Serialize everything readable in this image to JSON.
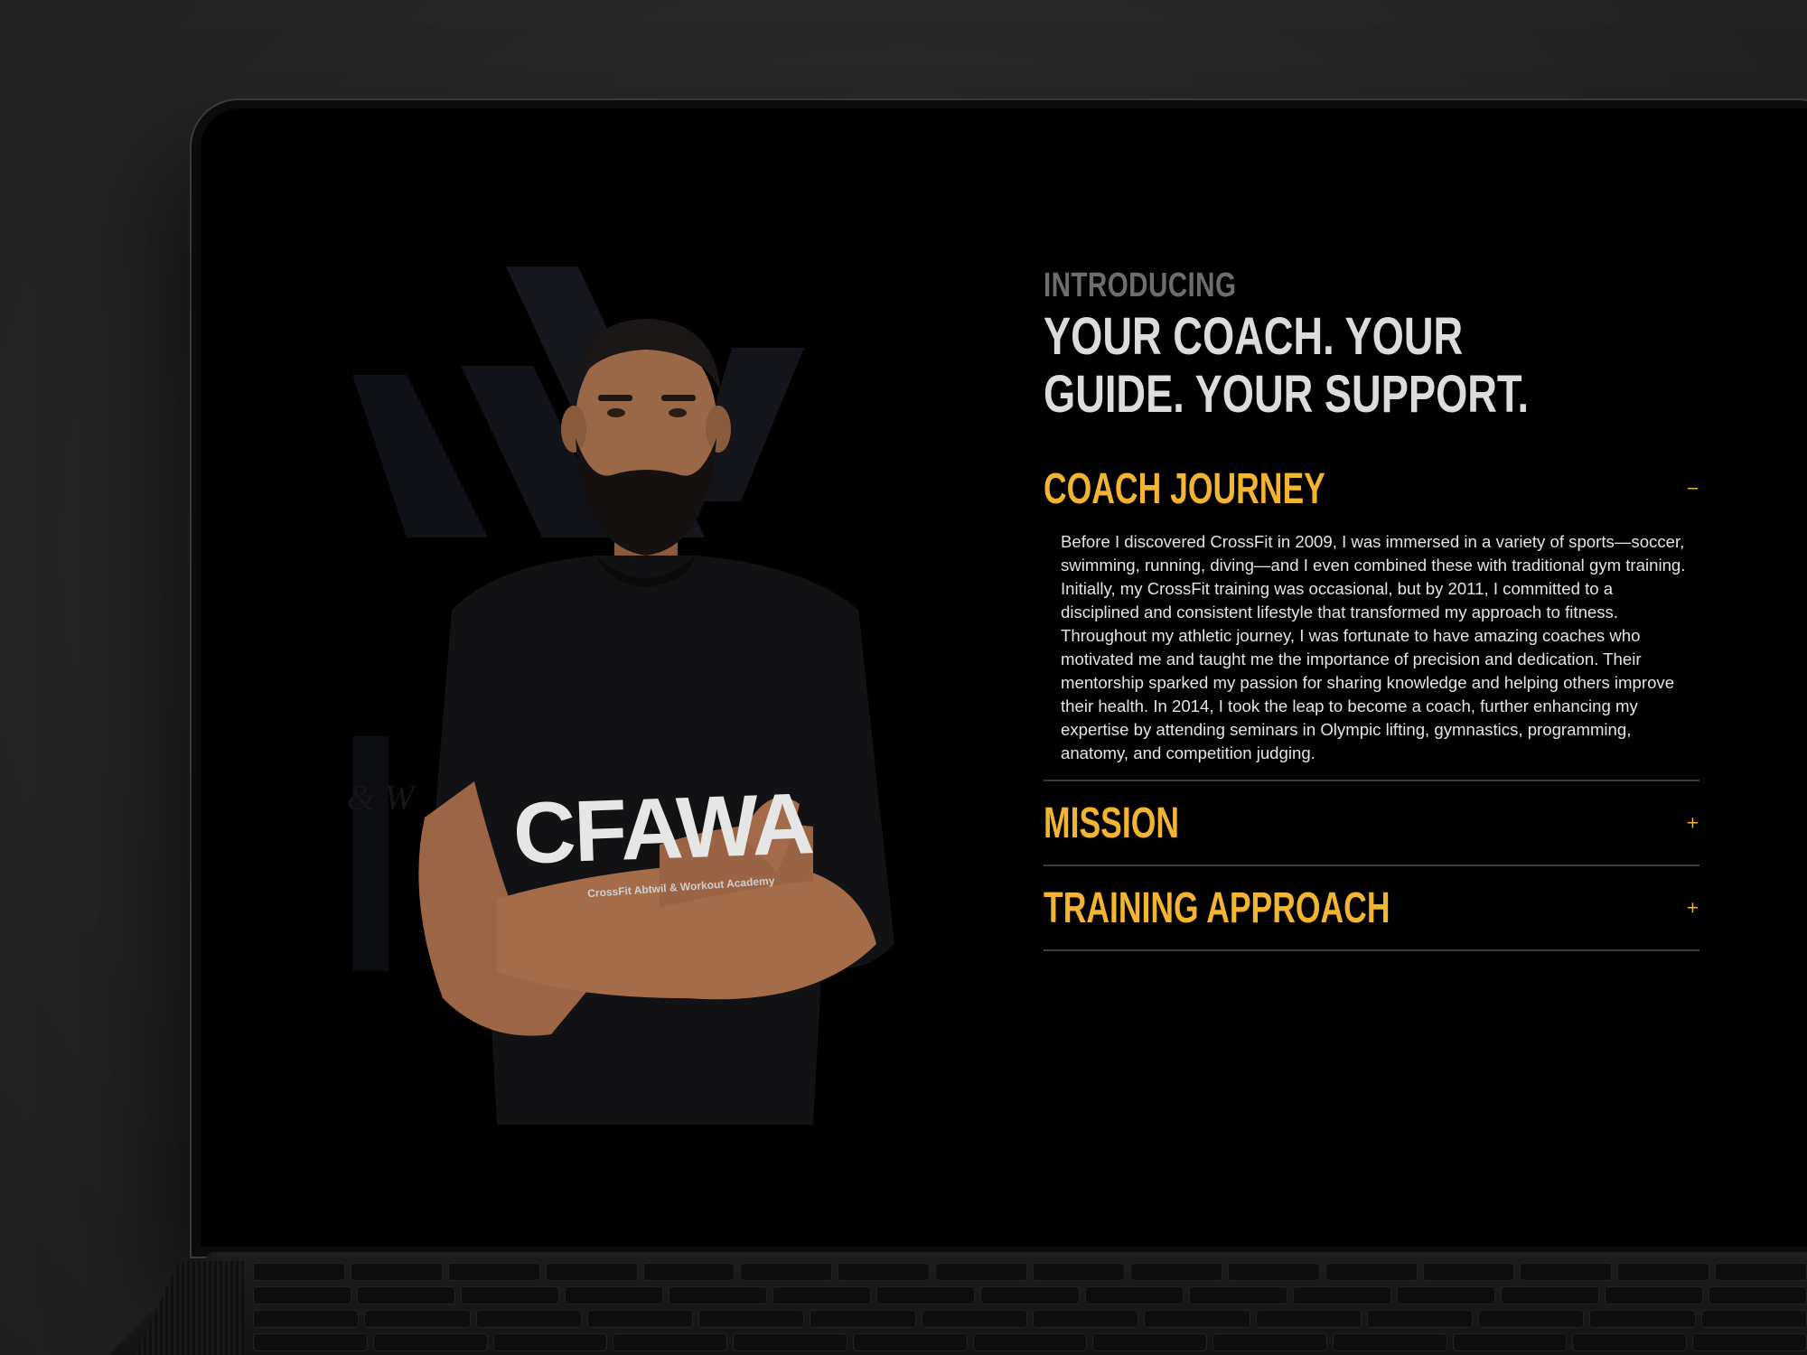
{
  "section": {
    "kicker": "INTRODUCING",
    "headline": "YOUR COACH. YOUR GUIDE. YOUR SUPPORT."
  },
  "photo": {
    "shirt_logo_text": "CFAWA",
    "shirt_subtext": "CrossFit Abtwil & Workout Academy",
    "background_logo_text": "& W"
  },
  "accordion": {
    "items": [
      {
        "title": "COACH JOURNEY",
        "toggle": "−",
        "expanded": true,
        "paragraphs": [
          "Before I discovered CrossFit in 2009, I was immersed in a variety of sports—soccer, swimming, running, diving—and I even combined these with traditional gym training. Initially, my CrossFit training was occasional, but by 2011, I committed to a disciplined and consistent lifestyle that transformed my approach to fitness.",
          "Throughout my athletic journey, I was fortunate to have amazing coaches who motivated me and taught me the importance of precision and dedication. Their mentorship sparked my passion for sharing knowledge and helping others improve their health. In 2014, I took the leap to become a coach, further enhancing my expertise by attending seminars in Olympic lifting, gymnastics, programming, anatomy, and competition judging."
        ]
      },
      {
        "title": "MISSION",
        "toggle": "+",
        "expanded": false
      },
      {
        "title": "TRAINING APPROACH",
        "toggle": "+",
        "expanded": false
      }
    ]
  },
  "colors": {
    "accent": "#f2b431",
    "background": "#000000",
    "headline": "#dcdcdc",
    "kicker": "#6d6d6d",
    "divider": "#3e3e3e"
  }
}
